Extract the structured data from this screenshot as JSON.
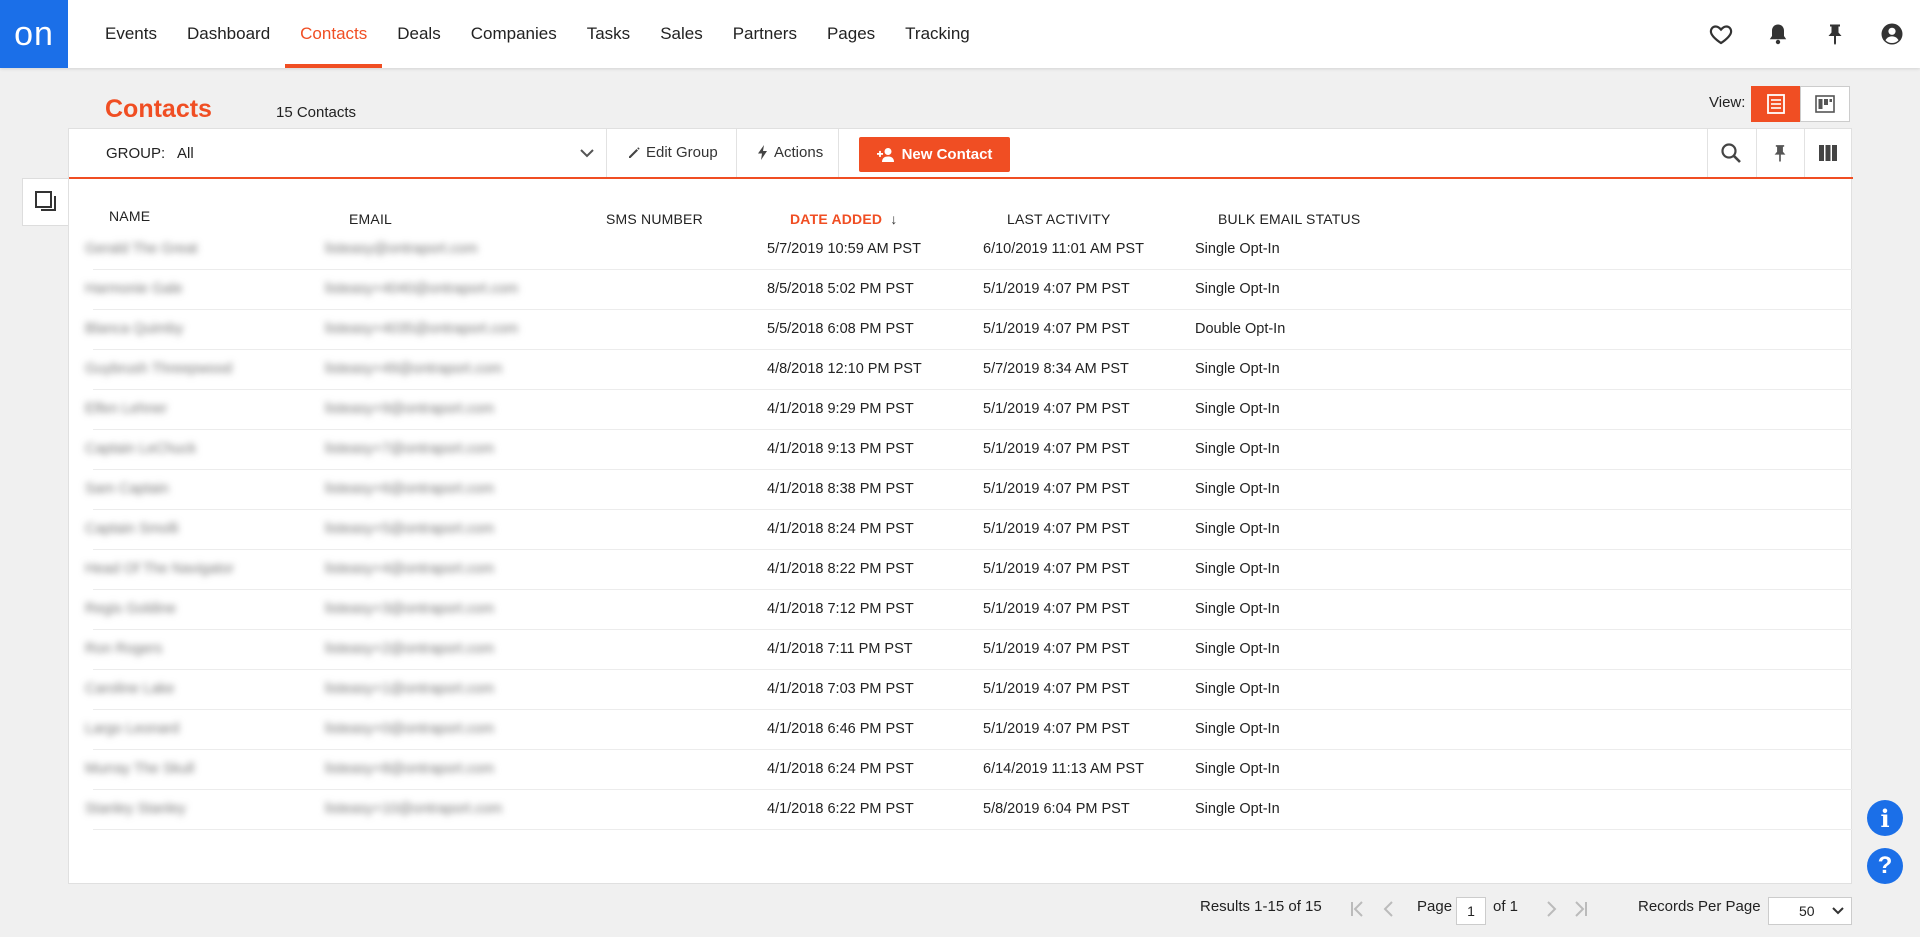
{
  "app": {
    "logo_text": "on",
    "nav": [
      "Events",
      "Dashboard",
      "Contacts",
      "Deals",
      "Companies",
      "Tasks",
      "Sales",
      "Partners",
      "Pages",
      "Tracking"
    ],
    "active_nav": "Contacts",
    "accent_color": "#f04e23",
    "brand_color": "#1b6fe8",
    "header_icons": [
      "heart-icon",
      "bell-icon",
      "pin-icon",
      "user-circle-icon"
    ]
  },
  "header": {
    "title": "Contacts",
    "count": "15 Contacts",
    "view_label": "View:"
  },
  "toolbar": {
    "group_label": "GROUP:",
    "group_value": "All",
    "edit_group": "Edit Group",
    "actions": "Actions",
    "new_contact": "New Contact"
  },
  "table": {
    "columns": [
      "NAME",
      "EMAIL",
      "SMS NUMBER",
      "DATE ADDED",
      "LAST ACTIVITY",
      "BULK EMAIL STATUS"
    ],
    "sort_indicator": "↓",
    "rows": [
      {
        "name": "Gerald The Great",
        "email": "listeasy@ontraport.com",
        "sms": "",
        "date_added": "5/7/2019 10:59 AM PST",
        "last_activity": "6/10/2019 11:01 AM PST",
        "status": "Single Opt-In"
      },
      {
        "name": "Harmonie Gale",
        "email": "listeasy+4040@ontraport.com",
        "sms": "",
        "date_added": "8/5/2018 5:02 PM PST",
        "last_activity": "5/1/2019 4:07 PM PST",
        "status": "Single Opt-In"
      },
      {
        "name": "Blanca Quimby",
        "email": "listeasy+4035@ontraport.com",
        "sms": "",
        "date_added": "5/5/2018 6:08 PM PST",
        "last_activity": "5/1/2019 4:07 PM PST",
        "status": "Double Opt-In"
      },
      {
        "name": "Guybrush Threepwood",
        "email": "listeasy+49@ontraport.com",
        "sms": "",
        "date_added": "4/8/2018 12:10 PM PST",
        "last_activity": "5/7/2019 8:34 AM PST",
        "status": "Single Opt-In"
      },
      {
        "name": "Elfen Lehner",
        "email": "listeasy+9@ontraport.com",
        "sms": "",
        "date_added": "4/1/2018 9:29 PM PST",
        "last_activity": "5/1/2019 4:07 PM PST",
        "status": "Single Opt-In"
      },
      {
        "name": "Captain LeChuck",
        "email": "listeasy+7@ontraport.com",
        "sms": "",
        "date_added": "4/1/2018 9:13 PM PST",
        "last_activity": "5/1/2019 4:07 PM PST",
        "status": "Single Opt-In"
      },
      {
        "name": "Sam Captain",
        "email": "listeasy+6@ontraport.com",
        "sms": "",
        "date_added": "4/1/2018 8:38 PM PST",
        "last_activity": "5/1/2019 4:07 PM PST",
        "status": "Single Opt-In"
      },
      {
        "name": "Captain Smolli",
        "email": "listeasy+5@ontraport.com",
        "sms": "",
        "date_added": "4/1/2018 8:24 PM PST",
        "last_activity": "5/1/2019 4:07 PM PST",
        "status": "Single Opt-In"
      },
      {
        "name": "Head Of The Navigator",
        "email": "listeasy+4@ontraport.com",
        "sms": "",
        "date_added": "4/1/2018 8:22 PM PST",
        "last_activity": "5/1/2019 4:07 PM PST",
        "status": "Single Opt-In"
      },
      {
        "name": "Regis Goldine",
        "email": "listeasy+3@ontraport.com",
        "sms": "",
        "date_added": "4/1/2018 7:12 PM PST",
        "last_activity": "5/1/2019 4:07 PM PST",
        "status": "Single Opt-In"
      },
      {
        "name": "Ron Rogers",
        "email": "listeasy+2@ontraport.com",
        "sms": "",
        "date_added": "4/1/2018 7:11 PM PST",
        "last_activity": "5/1/2019 4:07 PM PST",
        "status": "Single Opt-In"
      },
      {
        "name": "Caroline Lake",
        "email": "listeasy+1@ontraport.com",
        "sms": "",
        "date_added": "4/1/2018 7:03 PM PST",
        "last_activity": "5/1/2019 4:07 PM PST",
        "status": "Single Opt-In"
      },
      {
        "name": "Largo Leonard",
        "email": "listeasy+0@ontraport.com",
        "sms": "",
        "date_added": "4/1/2018 6:46 PM PST",
        "last_activity": "5/1/2019 4:07 PM PST",
        "status": "Single Opt-In"
      },
      {
        "name": "Murray The Skull",
        "email": "listeasy+8@ontraport.com",
        "sms": "",
        "date_added": "4/1/2018 6:24 PM PST",
        "last_activity": "6/14/2019 11:13 AM PST",
        "status": "Single Opt-In"
      },
      {
        "name": "Stanley Stanley",
        "email": "listeasy+10@ontraport.com",
        "sms": "",
        "date_added": "4/1/2018 6:22 PM PST",
        "last_activity": "5/8/2019 6:04 PM PST",
        "status": "Single Opt-In"
      }
    ]
  },
  "footer": {
    "results": "Results 1-15 of 15",
    "page_label": "Page",
    "page_value": "1",
    "of_label": "of 1",
    "records_label": "Records Per Page",
    "records_value": "50"
  },
  "help": {
    "info": "i",
    "question": "?"
  }
}
